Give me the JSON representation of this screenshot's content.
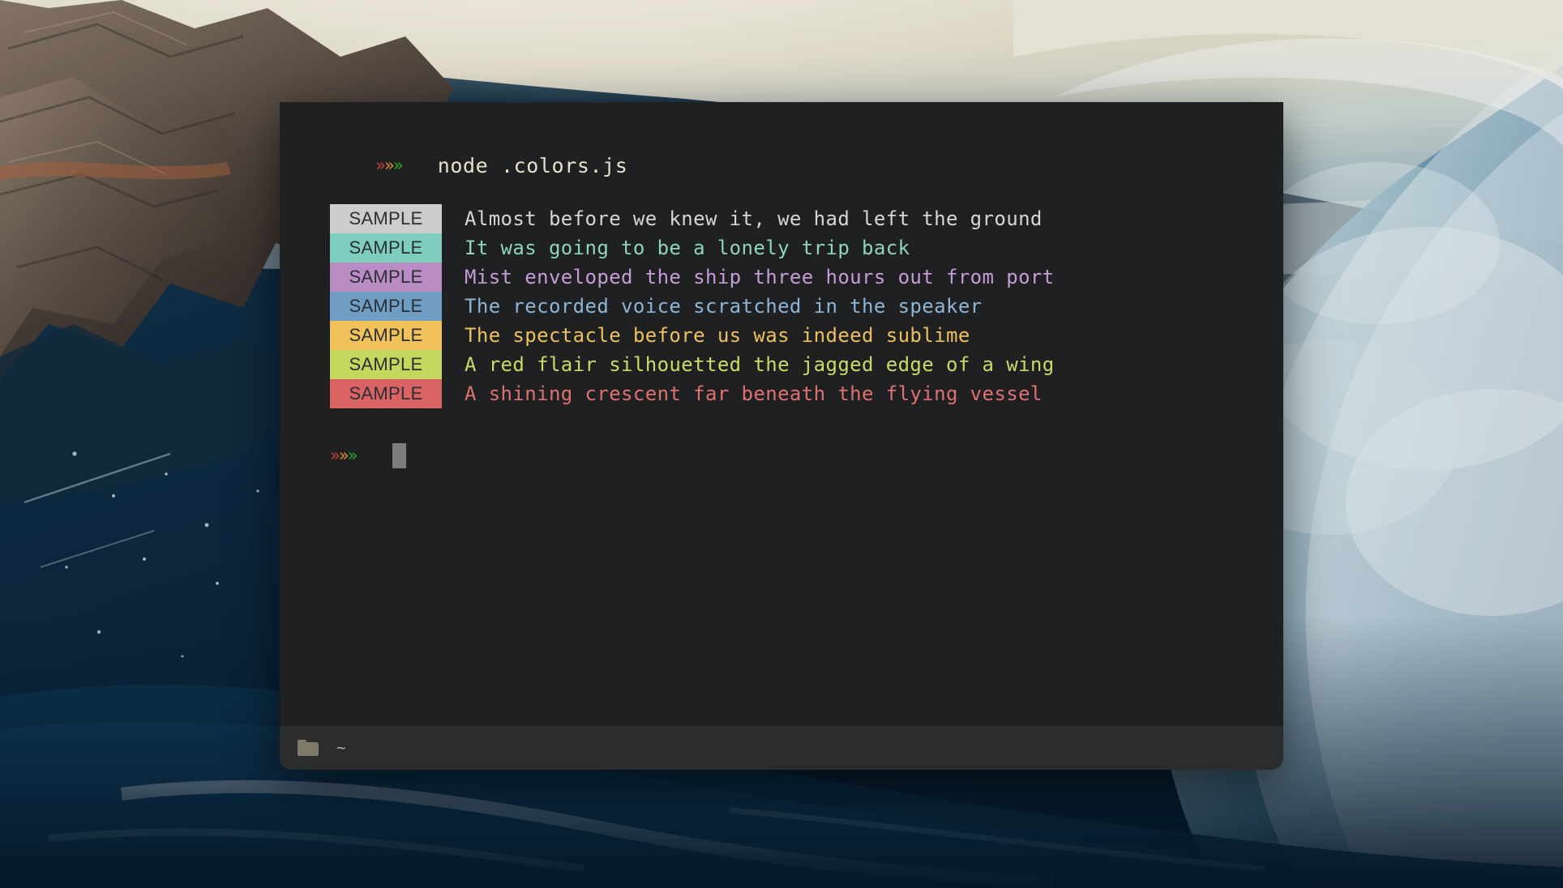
{
  "desktop": {
    "wallpaper_name": "ocean-wave-cliff-wallpaper",
    "colors": {
      "sky": "#efe8d2",
      "cliff_rock": "#6b5a4c",
      "deep_water": "#0d2b42",
      "foam_white": "#e6eef2",
      "mid_blue": "#1f5f83"
    }
  },
  "terminal": {
    "window_name": "terminal-window",
    "background": "#1e2022",
    "status_bar_background": "#2a2c2e",
    "prompt": {
      "chevrons": [
        "»",
        "»",
        "»"
      ],
      "chevron_colors": [
        "#c9403a",
        "#e08c2a",
        "#2aa828"
      ]
    },
    "command_line": {
      "command": "node .colors.js",
      "command_color": "#e8e0cc"
    },
    "sample_label": "SAMPLE",
    "sample_label_color": "#2b2f34",
    "output_rows": [
      {
        "swatch_color": "#cccccc",
        "text": "Almost before we knew it, we had left the ground",
        "text_color": "#d6d6d6"
      },
      {
        "swatch_color": "#7ecec0",
        "text": "It was going to be a lonely trip back",
        "text_color": "#8fd4bd"
      },
      {
        "swatch_color": "#b98cc4",
        "text": "Mist enveloped the ship three hours out from port",
        "text_color": "#c79cd6"
      },
      {
        "swatch_color": "#6f9dc4",
        "text": "The recorded voice scratched in the speaker",
        "text_color": "#8fb4d4"
      },
      {
        "swatch_color": "#f0c259",
        "text": "The spectacle before us was indeed sublime",
        "text_color": "#edc05b"
      },
      {
        "swatch_color": "#c4d65c",
        "text": "A red flair silhouetted the jagged edge of a wing",
        "text_color": "#ccdb63"
      },
      {
        "swatch_color": "#da6464",
        "text": "A shining crescent far beneath the flying vessel",
        "text_color": "#df7070"
      }
    ],
    "cursor": {
      "name": "block-cursor",
      "color": "#7c7c7c"
    },
    "status_bar": {
      "folder_icon": "folder-icon",
      "path": "~",
      "path_color": "#b9b4a4"
    }
  }
}
